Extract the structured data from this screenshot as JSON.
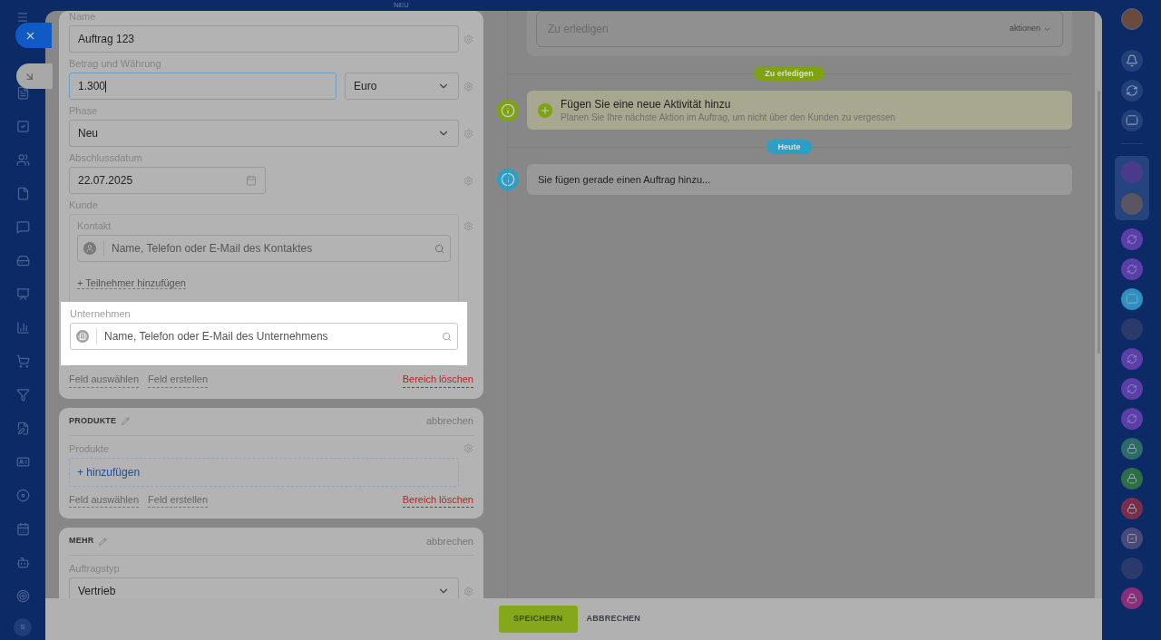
{
  "topbar": {
    "badge": "NEU"
  },
  "left_nav": {
    "user_initial": "S"
  },
  "sections": [
    {
      "fields": [
        {
          "kind": "text",
          "label": "Name",
          "value": "Auftrag 123"
        },
        {
          "kind": "money",
          "label": "Betrag und Währung",
          "value": "1.300",
          "focused": true,
          "currency": "Euro"
        },
        {
          "kind": "select",
          "label": "Phase",
          "value": "Neu"
        },
        {
          "kind": "date",
          "label": "Abschlussdatum",
          "value": "22.07.2025"
        },
        {
          "kind": "client",
          "label": "Kunde",
          "contact_label": "Kontakt",
          "contact_placeholder": "Name, Telefon oder E-Mail des Kontaktes",
          "add_participant": "+ Teilnehmer hinzufügen",
          "company_label": "Unternehmen",
          "company_placeholder": "Name, Telefon oder E-Mail des Unternehmens",
          "company_highlighted": true
        }
      ],
      "links": [
        "Feld auswählen",
        "Feld erstellen"
      ],
      "delete": "Bereich löschen"
    },
    {
      "title": "PRODUKTE",
      "cancel": "abbrechen",
      "fields": [
        {
          "kind": "products",
          "label": "Produkte",
          "action": "+ hinzufügen"
        }
      ],
      "links": [
        "Feld auswählen",
        "Feld erstellen"
      ],
      "delete": "Bereich löschen"
    },
    {
      "title": "MEHR",
      "cancel": "abbrechen",
      "fields": [
        {
          "kind": "select",
          "label": "Auftragstyp",
          "value": "Vertrieb"
        }
      ]
    }
  ],
  "timeline": {
    "todo_field": {
      "placeholder": "Zu erledigen",
      "actions": "aktionen"
    },
    "groups": [
      {
        "label": "Zu erledigen",
        "color": "#7fa212",
        "items": [
          {
            "kind": "add",
            "title": "Fügen Sie eine neue Aktivität hinzu",
            "subtitle": "Planen Sie Ihre nächste Aktion im Auftrag, um nicht über den Kunden zu vergessen"
          }
        ]
      },
      {
        "label": "Heute",
        "color": "#2b9fc6",
        "items": [
          {
            "kind": "info",
            "text": "Sie fügen gerade einen Auftrag hinzu..."
          }
        ]
      }
    ]
  },
  "footer": {
    "buttons": [
      {
        "kind": "primary",
        "label": "SPEICHERN"
      },
      {
        "kind": "secondary",
        "label": "ABBRECHEN"
      }
    ]
  }
}
